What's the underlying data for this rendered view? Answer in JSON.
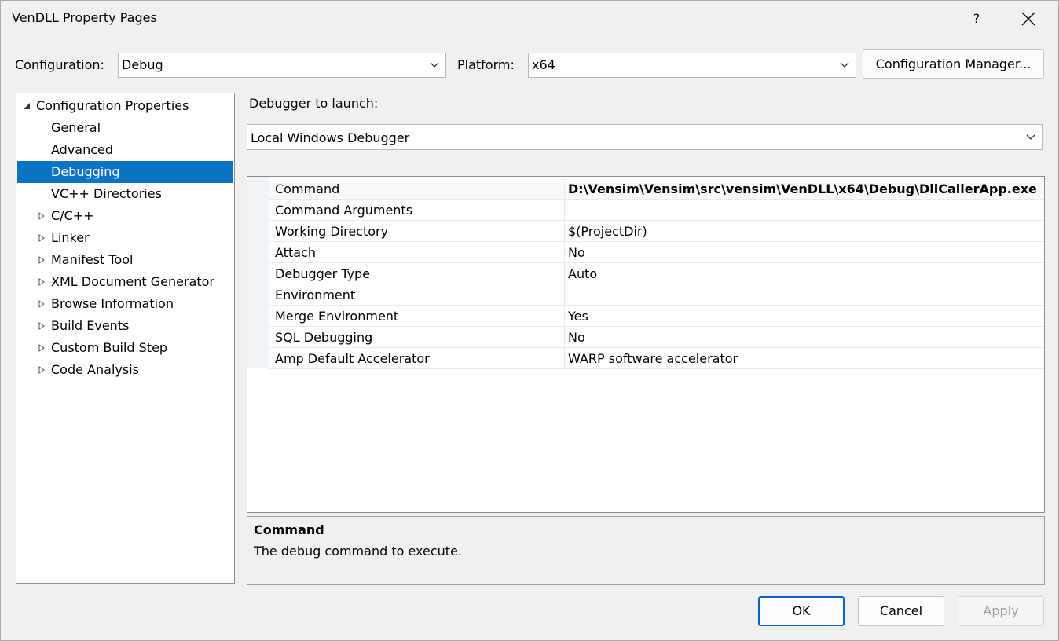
{
  "window": {
    "title": "VenDLL Property Pages",
    "help_label": "?"
  },
  "config_bar": {
    "configuration_label": "Configuration:",
    "configuration_value": "Debug",
    "platform_label": "Platform:",
    "platform_value": "x64",
    "config_manager_label": "Configuration Manager..."
  },
  "tree": {
    "items": [
      {
        "label": "Configuration Properties",
        "expand": "expanded"
      },
      {
        "label": "General",
        "expand": "none"
      },
      {
        "label": "Advanced",
        "expand": "none"
      },
      {
        "label": "Debugging",
        "expand": "none",
        "selected": true
      },
      {
        "label": "VC++ Directories",
        "expand": "none"
      },
      {
        "label": "C/C++",
        "expand": "collapsed"
      },
      {
        "label": "Linker",
        "expand": "collapsed"
      },
      {
        "label": "Manifest Tool",
        "expand": "collapsed"
      },
      {
        "label": "XML Document Generator",
        "expand": "collapsed"
      },
      {
        "label": "Browse Information",
        "expand": "collapsed"
      },
      {
        "label": "Build Events",
        "expand": "collapsed"
      },
      {
        "label": "Custom Build Step",
        "expand": "collapsed"
      },
      {
        "label": "Code Analysis",
        "expand": "collapsed"
      }
    ]
  },
  "debugger": {
    "launch_label": "Debugger to launch:",
    "launch_value": "Local Windows Debugger"
  },
  "properties": [
    {
      "name": "Command",
      "value": "D:\\Vensim\\Vensim\\src\\vensim\\VenDLL\\x64\\Debug\\DllCallerApp.exe"
    },
    {
      "name": "Command Arguments",
      "value": ""
    },
    {
      "name": "Working Directory",
      "value": "$(ProjectDir)"
    },
    {
      "name": "Attach",
      "value": "No"
    },
    {
      "name": "Debugger Type",
      "value": "Auto"
    },
    {
      "name": "Environment",
      "value": ""
    },
    {
      "name": "Merge Environment",
      "value": "Yes"
    },
    {
      "name": "SQL Debugging",
      "value": "No"
    },
    {
      "name": "Amp Default Accelerator",
      "value": "WARP software accelerator"
    }
  ],
  "description": {
    "title": "Command",
    "text": "The debug command to execute."
  },
  "footer": {
    "ok_label": "OK",
    "cancel_label": "Cancel",
    "apply_label": "Apply"
  },
  "colors": {
    "selection": "#0a74c4",
    "ok_border": "#0067c0",
    "disabled_text": "#a0a0a0"
  }
}
